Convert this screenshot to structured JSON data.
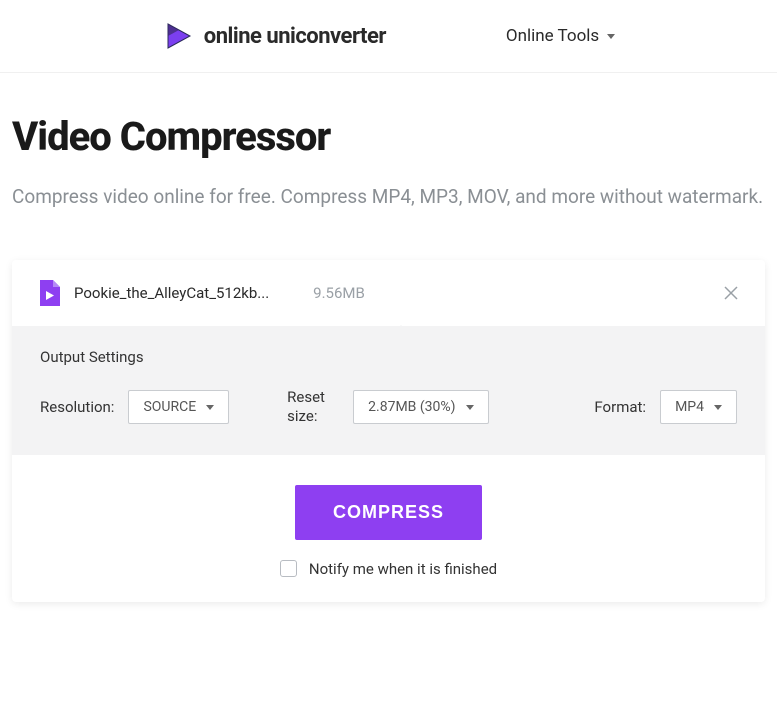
{
  "header": {
    "brand": "online uniconverter",
    "nav_tools": "Online Tools"
  },
  "page": {
    "title": "Video Compressor",
    "subtitle": "Compress video online for free. Compress MP4, MP3, MOV, and more without watermark."
  },
  "file": {
    "name": "Pookie_the_AlleyCat_512kb...",
    "size": "9.56MB"
  },
  "settings": {
    "heading": "Output Settings",
    "resolution_label": "Resolution:",
    "resolution_value": "SOURCE",
    "reset_size_label": "Reset size:",
    "reset_size_value": "2.87MB (30%)",
    "format_label": "Format:",
    "format_value": "MP4"
  },
  "actions": {
    "compress": "COMPRESS",
    "notify": "Notify me when it is finished"
  }
}
